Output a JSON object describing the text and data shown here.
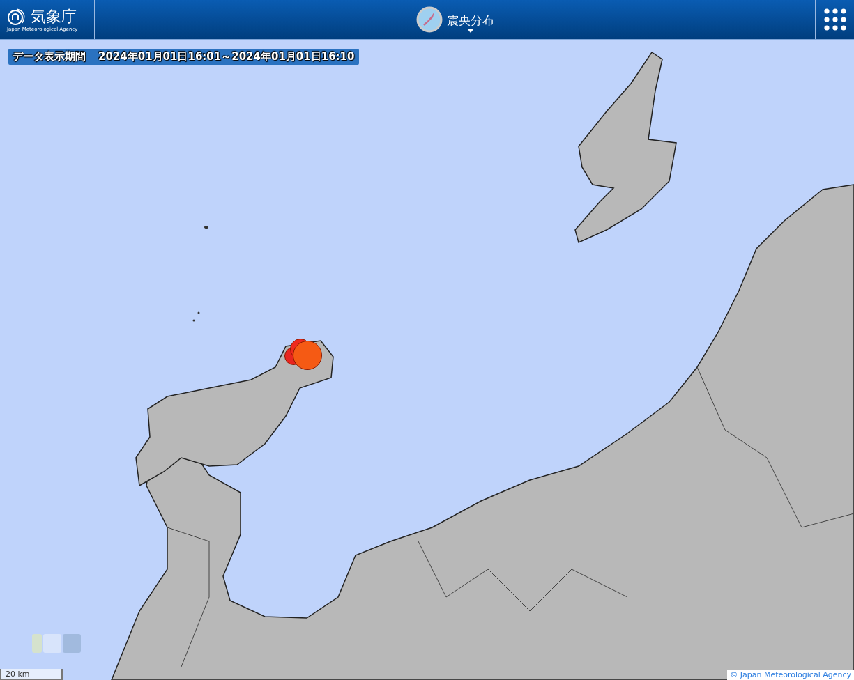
{
  "header": {
    "logo_name": "気象庁",
    "logo_subtitle": "Japan Meteorological Agency",
    "title": "震央分布"
  },
  "period": {
    "label": "データ表示期間",
    "value": "2024年01月01日16:01～2024年01月01日16:10"
  },
  "scale": "20 km",
  "attribution": "© Japan Meteorological Agency"
}
